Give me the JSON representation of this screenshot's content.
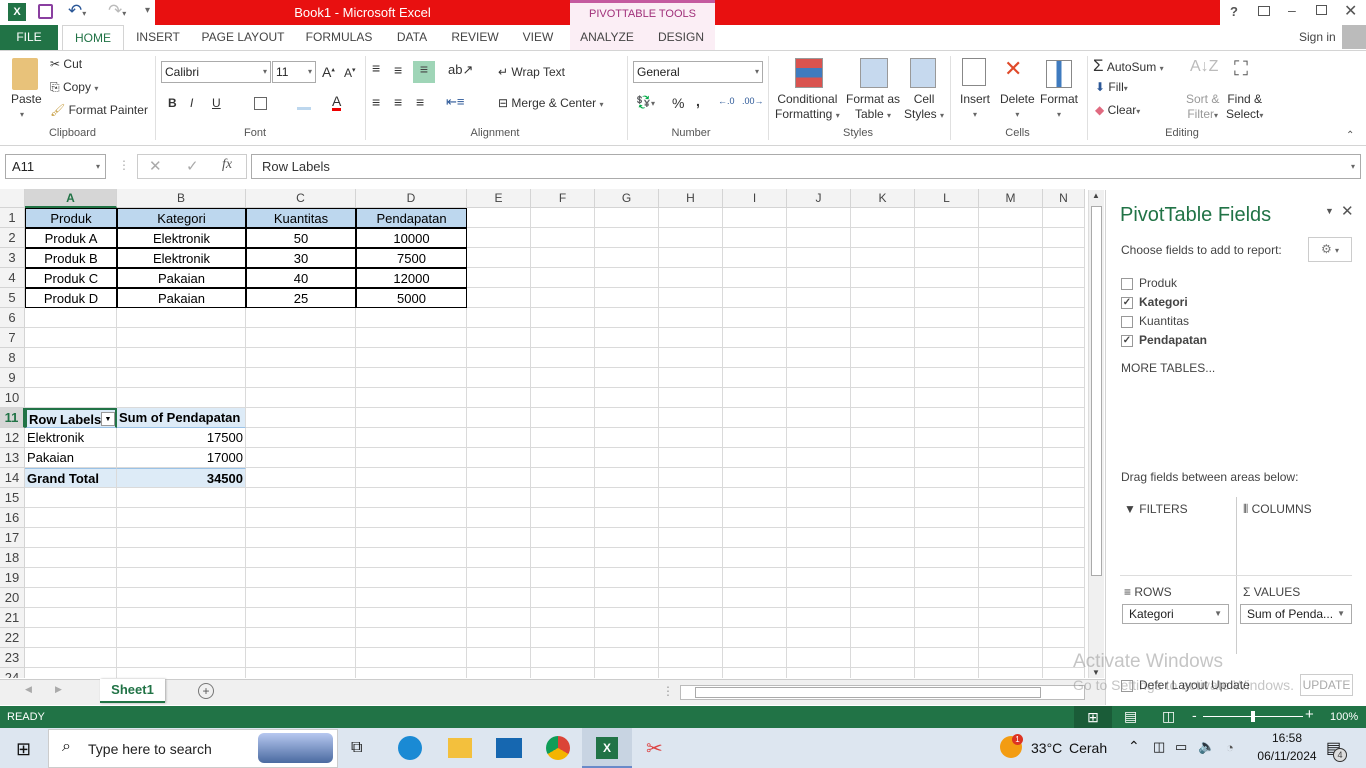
{
  "window": {
    "title": "Book1 -  Microsoft Excel",
    "contextual_tab": "PIVOTTABLE TOOLS",
    "sign_in": "Sign in",
    "help": "?"
  },
  "tabs": [
    "FILE",
    "HOME",
    "INSERT",
    "PAGE LAYOUT",
    "FORMULAS",
    "DATA",
    "REVIEW",
    "VIEW",
    "ANALYZE",
    "DESIGN"
  ],
  "ribbon": {
    "clipboard": {
      "paste": "Paste",
      "cut": "Cut",
      "copy": "Copy",
      "format_painter": "Format Painter",
      "label": "Clipboard"
    },
    "font": {
      "name": "Calibri",
      "size": "11",
      "bold": "B",
      "italic": "I",
      "underline": "U",
      "label": "Font"
    },
    "alignment": {
      "wrap": "Wrap Text",
      "merge": "Merge & Center",
      "label": "Alignment"
    },
    "number": {
      "format": "General",
      "percent": "%",
      "comma": ",",
      "label": "Number"
    },
    "styles": {
      "conditional": [
        "Conditional",
        "Formatting"
      ],
      "format_table": [
        "Format as",
        "Table"
      ],
      "cell_styles": [
        "Cell",
        "Styles"
      ],
      "label": "Styles"
    },
    "cells": {
      "insert": "Insert",
      "delete": "Delete",
      "format": "Format",
      "label": "Cells"
    },
    "editing": {
      "autosum": "AutoSum",
      "fill": "Fill",
      "clear": "Clear",
      "sort": [
        "Sort &",
        "Filter"
      ],
      "find": [
        "Find &",
        "Select"
      ],
      "label": "Editing"
    }
  },
  "formula_bar": {
    "name_box": "A11",
    "fx": "fx",
    "value": "Row Labels"
  },
  "columns": [
    "A",
    "B",
    "C",
    "D",
    "E",
    "F",
    "G",
    "H",
    "I",
    "J",
    "K",
    "L",
    "M",
    "N"
  ],
  "rows": [
    "1",
    "2",
    "3",
    "4",
    "5",
    "6",
    "7",
    "8",
    "9",
    "10",
    "11",
    "12",
    "13",
    "14",
    "15",
    "16",
    "17",
    "18",
    "19",
    "20",
    "21",
    "22",
    "23",
    "24"
  ],
  "table": {
    "headers": [
      "Produk",
      "Kategori",
      "Kuantitas",
      "Pendapatan"
    ],
    "rows": [
      [
        "Produk A",
        "Elektronik",
        "50",
        "10000"
      ],
      [
        "Produk B",
        "Elektronik",
        "30",
        "7500"
      ],
      [
        "Produk C",
        "Pakaian",
        "40",
        "12000"
      ],
      [
        "Produk D",
        "Pakaian",
        "25",
        "5000"
      ]
    ]
  },
  "pivot": {
    "header": [
      "Row Labels",
      "Sum of Pendapatan"
    ],
    "rows": [
      [
        "Elektronik",
        "17500"
      ],
      [
        "Pakaian",
        "17000"
      ]
    ],
    "total": [
      "Grand Total",
      "34500"
    ]
  },
  "sheet_tab": "Sheet1",
  "pane": {
    "title": "PivotTable Fields",
    "subtitle": "Choose fields to add to report:",
    "fields": [
      {
        "name": "Produk",
        "checked": false
      },
      {
        "name": "Kategori",
        "checked": true
      },
      {
        "name": "Kuantitas",
        "checked": false
      },
      {
        "name": "Pendapatan",
        "checked": true
      }
    ],
    "more_tables": "MORE TABLES...",
    "drag_hint": "Drag fields between areas below:",
    "filters": "FILTERS",
    "columns": "COLUMNS",
    "rows": "ROWS",
    "values": "VALUES",
    "rows_item": "Kategori",
    "values_item": "Sum of Penda...",
    "defer": "Defer Layout Update",
    "update": "UPDATE",
    "watermark1": "Activate Windows",
    "watermark2": "Go to Settings to activate Windows."
  },
  "status": {
    "ready": "READY",
    "zoom": "100%",
    "zoom_level": 100
  },
  "taskbar": {
    "search": "Type here to search",
    "temp": "33°C",
    "weather": "Cerah",
    "time": "16:58",
    "date": "06/11/2024",
    "notifications": "4",
    "weather_badge": "1"
  },
  "colors": {
    "excel_green": "#217346",
    "title_red": "#e81010",
    "header_fill": "#bdd7ee",
    "pivot_fill": "#ddebf7"
  }
}
